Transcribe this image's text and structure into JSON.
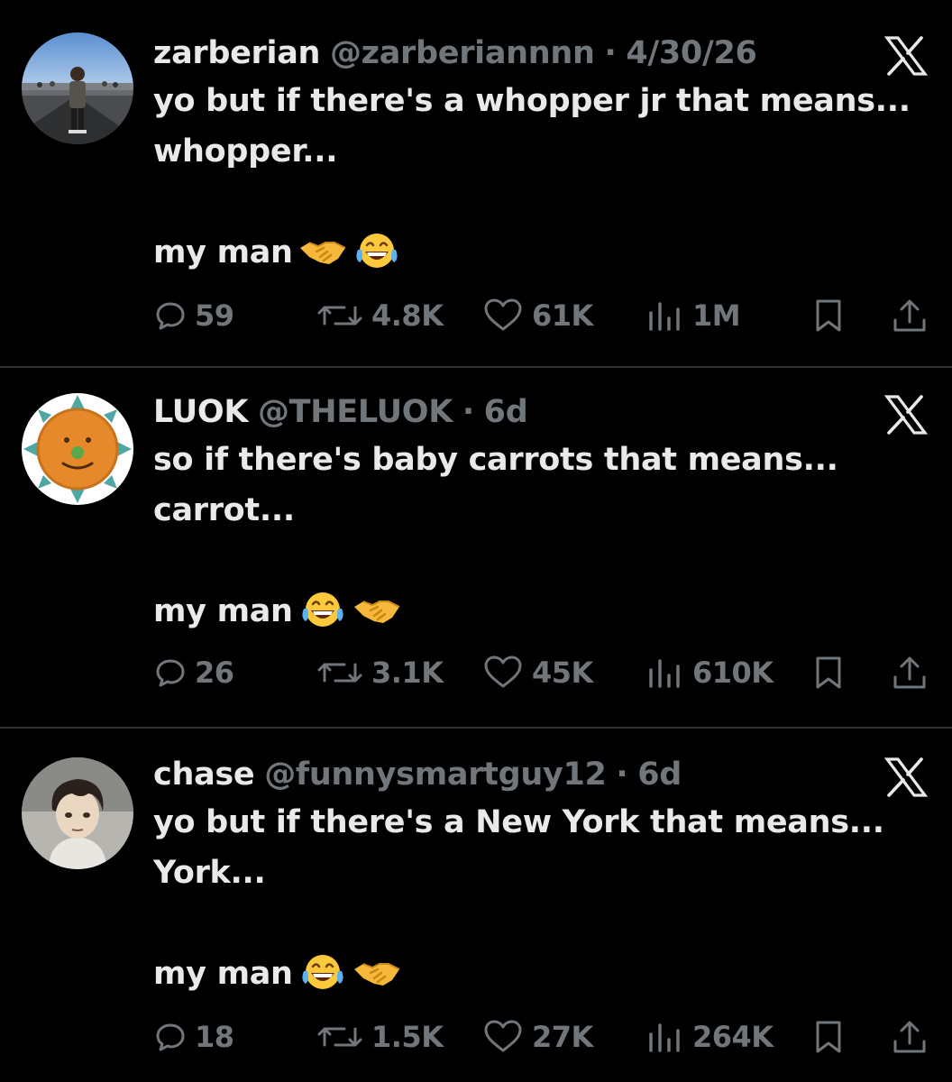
{
  "tweets": [
    {
      "name": "zarberian",
      "handle": "@zarberiannnn",
      "separator": "·",
      "time": "4/30/26",
      "lines": [
        "yo but if there's a whopper jr that means...",
        "whopper..."
      ],
      "closing": "my man",
      "emojis": [
        "handshake-emoji",
        "laughing-crying-emoji"
      ],
      "replies": "59",
      "reposts": "4.8K",
      "likes": "61K",
      "views": "1M"
    },
    {
      "name": "LUOK",
      "handle": "@THELUOK",
      "separator": "·",
      "time": "6d",
      "lines": [
        "so if there's baby carrots that means...",
        "carrot..."
      ],
      "closing": "my man",
      "emojis": [
        "laughing-crying-emoji",
        "handshake-emoji"
      ],
      "replies": "26",
      "reposts": "3.1K",
      "likes": "45K",
      "views": "610K"
    },
    {
      "name": "chase",
      "handle": "@funnysmartguy12",
      "separator": "·",
      "time": "6d",
      "lines": [
        "yo but if there's a New York that means...",
        "York..."
      ],
      "closing": "my man",
      "emojis": [
        "laughing-crying-emoji",
        "handshake-emoji"
      ],
      "replies": "18",
      "reposts": "1.5K",
      "likes": "27K",
      "views": "264K"
    }
  ],
  "colors": {
    "background": "#000000",
    "text": "#e7e9ea",
    "secondary": "#71767b",
    "divider": "#2f3336"
  }
}
